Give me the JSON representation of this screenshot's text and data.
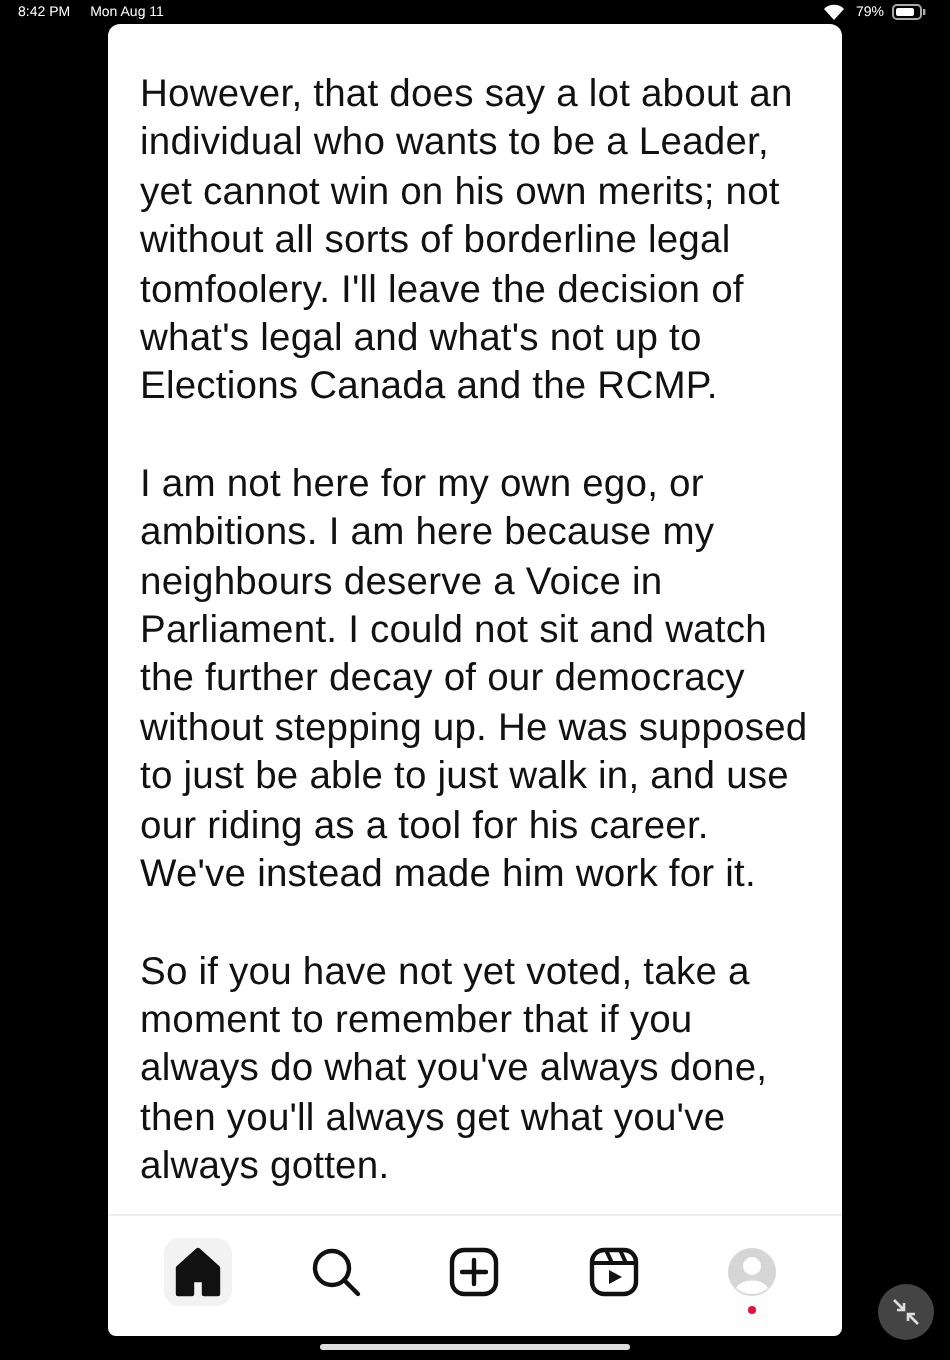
{
  "status_bar": {
    "time": "8:42 PM",
    "date": "Mon Aug 11",
    "battery": "79%"
  },
  "post": {
    "paragraphs": [
      "However, that does say a lot about an individual who wants to be a Leader, yet cannot win on his own merits; not without all sorts of borderline legal tomfoolery. I'll leave the decision of what's legal and what's not up to Elections Canada and the RCMP.",
      "I am not here for my own ego, or ambitions. I am here because my neighbours deserve a Voice in Parliament. I could not sit and watch the further decay of our democracy without stepping up. He was supposed to just be able to just walk in, and use our riding as a tool for his career. We've instead made him work for it.",
      "So if you have not yet voted, take a moment to remember that if you always do what you've always done, then you'll always get what you've always gotten."
    ]
  },
  "nav": [
    {
      "kind": "home",
      "selected": true
    },
    {
      "kind": "search",
      "selected": false
    },
    {
      "kind": "create",
      "selected": false
    },
    {
      "kind": "reels",
      "selected": false
    },
    {
      "kind": "profile",
      "selected": false,
      "notification": true
    }
  ]
}
